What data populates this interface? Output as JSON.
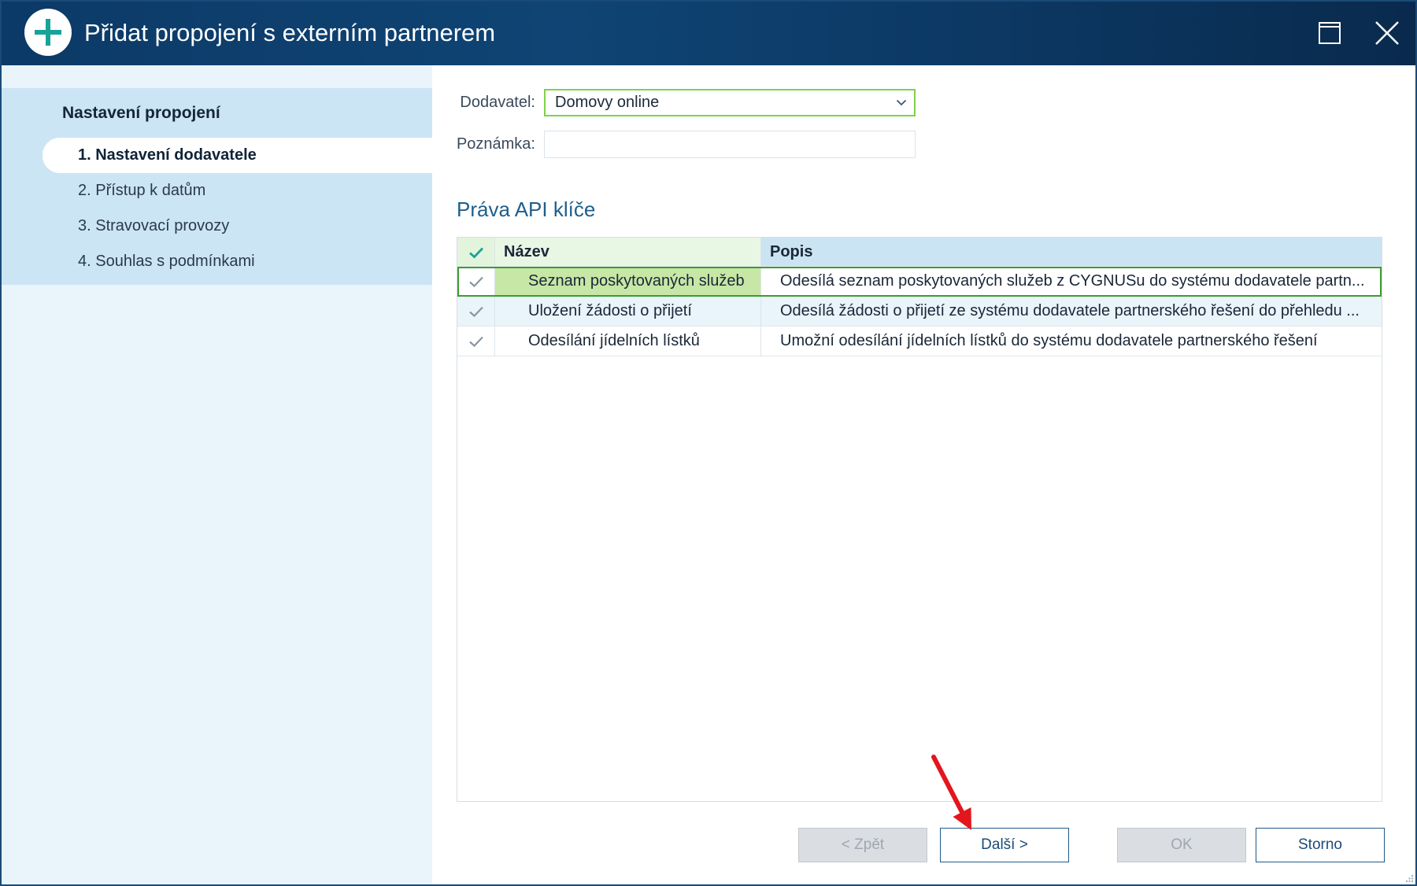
{
  "window": {
    "title": "Přidat propojení s externím partnerem",
    "app_icon": "plus-circle-icon",
    "maximize_icon": "maximize-icon",
    "close_icon": "close-icon"
  },
  "sidebar": {
    "heading": "Nastavení propojení",
    "steps": [
      {
        "label": "1. Nastavení dodavatele",
        "active": true
      },
      {
        "label": "2. Přístup k datům",
        "active": false
      },
      {
        "label": "3. Stravovací provozy",
        "active": false
      },
      {
        "label": "4. Souhlas s podmínkami",
        "active": false
      }
    ]
  },
  "form": {
    "supplier": {
      "label": "Dodavatel:",
      "value": "Domovy online",
      "icon": "chevron-down-icon"
    },
    "note": {
      "label": "Poznámka:",
      "value": ""
    }
  },
  "permissions": {
    "title": "Práva API klíče",
    "header": {
      "check_icon": "check-icon",
      "name": "Název",
      "description": "Popis"
    },
    "rows": [
      {
        "checked": true,
        "selected": true,
        "name": "Seznam poskytovaných služeb",
        "description": "Odesílá seznam poskytovaných služeb z CYGNUSu do systému dodavatele partn..."
      },
      {
        "checked": true,
        "selected": false,
        "name": "Uložení žádosti o přijetí",
        "description": "Odesílá žádosti o přijetí ze systému dodavatele partnerského řešení do přehledu ..."
      },
      {
        "checked": true,
        "selected": false,
        "name": "Odesílání jídelních lístků",
        "description": "Umožní odesílání jídelních lístků do systému dodavatele partnerského řešení"
      }
    ]
  },
  "buttons": {
    "back": {
      "label": "< Zpět",
      "disabled": true
    },
    "next": {
      "label": "Další >",
      "disabled": false
    },
    "ok": {
      "label": "OK",
      "disabled": true
    },
    "cancel": {
      "label": "Storno",
      "disabled": false
    }
  },
  "colors": {
    "accent": "#17a398",
    "titlebar_left": "#0c3a67",
    "titlebar_right": "#092a4d",
    "frame": "#1a4a78",
    "sidebar_bg": "#e9f4fb",
    "sidebar_section": "#cbe5f4",
    "heading": "#1f5e8c",
    "valid_border": "#7fd14a",
    "selection_border": "#3d9b30",
    "selection_fill": "#c6e7a6",
    "row_alt": "#e9f4fb",
    "header_green": "#e8f6e4",
    "header_blue": "#cbe4f3",
    "button_border": "#1f5a89",
    "annotation_arrow": "#e3161e"
  }
}
